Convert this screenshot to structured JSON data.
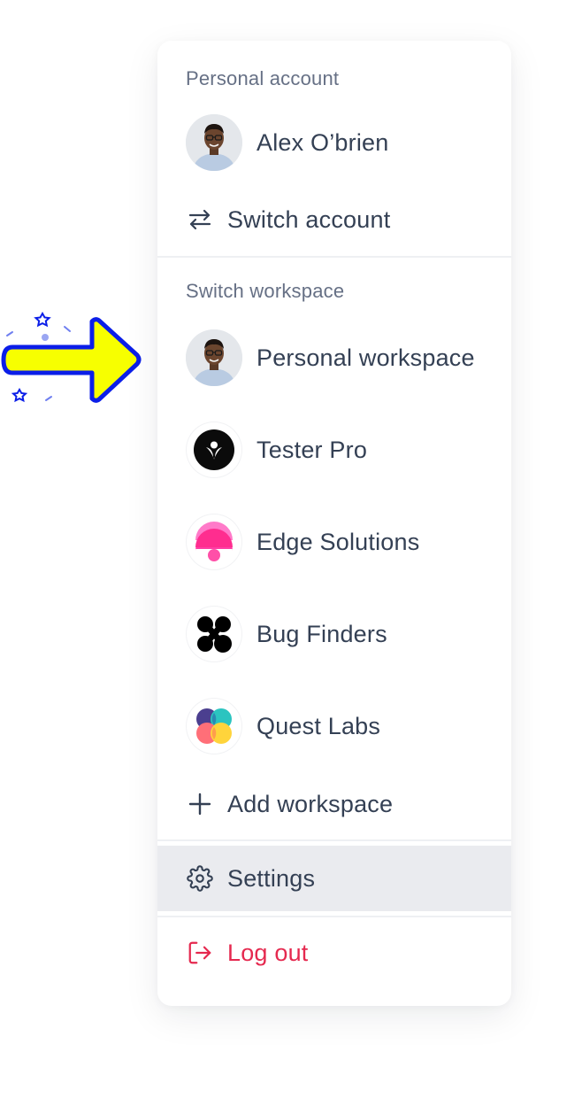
{
  "personal_account": {
    "section_label": "Personal account",
    "user_name": "Alex O’brien",
    "switch_account_label": "Switch account"
  },
  "workspaces": {
    "section_label": "Switch workspace",
    "items": [
      {
        "label": "Personal workspace",
        "icon": "avatar"
      },
      {
        "label": "Tester Pro",
        "icon": "tester-pro-logo"
      },
      {
        "label": "Edge Solutions",
        "icon": "edge-solutions-logo"
      },
      {
        "label": "Bug Finders",
        "icon": "bug-finders-logo"
      },
      {
        "label": "Quest Labs",
        "icon": "quest-labs-logo"
      }
    ],
    "add_label": "Add workspace"
  },
  "footer": {
    "settings_label": "Settings",
    "logout_label": "Log out"
  },
  "colors": {
    "text": "#344054",
    "muted": "#667085",
    "danger": "#e5294f",
    "highlight": "#eaebef",
    "arrow_fill": "#f7ff00",
    "arrow_stroke": "#0b1ee8"
  }
}
